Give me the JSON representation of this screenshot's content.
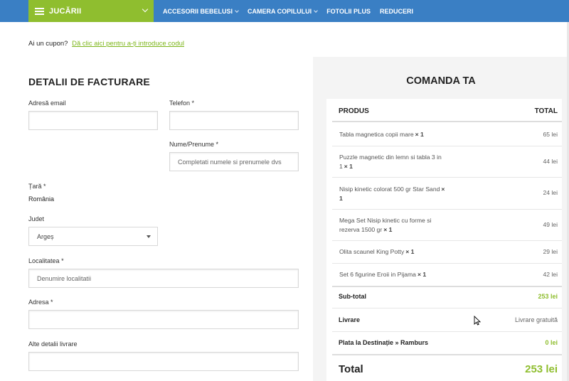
{
  "nav": {
    "category_label": "JUCĂRII",
    "items": [
      {
        "label": "ACCESORII BEBELUSI",
        "has_dropdown": true
      },
      {
        "label": "CAMERA COPILULUI",
        "has_dropdown": true
      },
      {
        "label": "FOTOLII PLUS",
        "has_dropdown": false
      },
      {
        "label": "REDUCERI",
        "has_dropdown": false
      }
    ]
  },
  "coupon": {
    "question": "Ai un cupon?",
    "link": "Dă clic aici pentru a-ți introduce codul"
  },
  "billing": {
    "title": "DETALII DE FACTURARE",
    "email_label": "Adresă email",
    "phone_label": "Telefon",
    "name_label": "Nume/Prenume",
    "name_placeholder": "Completati numele si prenumele dvs",
    "country_label": "Țară",
    "country_value": "România",
    "county_label": "Judet",
    "county_value": "Argeș",
    "city_label": "Localitatea",
    "city_placeholder": "Denumire localitatii",
    "address_label": "Adresa",
    "other_label": "Alte detalii livrare",
    "required_mark": "*"
  },
  "order": {
    "title": "COMANDA TA",
    "col_product": "PRODUS",
    "col_total": "TOTAL",
    "items": [
      {
        "name": "Tabla magnetica copii mare",
        "qty": "× 1",
        "price": "65 lei"
      },
      {
        "name": "Puzzle magnetic din lemn si tabla 3 in 1",
        "qty": "× 1",
        "price": "44 lei"
      },
      {
        "name": "Nisip kinetic colorat 500 gr Star Sand",
        "qty": "× 1",
        "price": "24 lei"
      },
      {
        "name": "Mega Set Nisip kinetic cu forme si rezerva 1500 gr",
        "qty": "× 1",
        "price": "49 lei"
      },
      {
        "name": "Olita scaunel King Potty",
        "qty": "× 1",
        "price": "29 lei"
      },
      {
        "name": "Set 6 figurine Eroii in Pijama",
        "qty": "× 1",
        "price": "42 lei"
      }
    ],
    "subtotal_label": "Sub-total",
    "subtotal_value": "253 lei",
    "shipping_label": "Livrare",
    "shipping_value": "Livrare gratuită",
    "payment_label": "Plata la Destinație » Ramburs",
    "payment_value": "0 lei",
    "total_label": "Total",
    "total_value": "253 lei"
  },
  "colors": {
    "nav_blue": "#3a7fc4",
    "accent_green": "#8fbe2f",
    "panel_gray": "#f4f4f4"
  }
}
